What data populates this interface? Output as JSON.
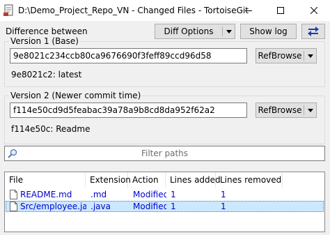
{
  "window": {
    "title": "D:\\Demo_Project_Repo_VN - Changed Files - TortoiseGit",
    "minimize_icon": "minimize-icon",
    "maximize_icon": "maximize-icon",
    "close_icon": "close-icon"
  },
  "header": {
    "difference_label": "Difference between",
    "diff_options_label": "Diff Options",
    "show_log_label": "Show log",
    "swap_icon": "swap-arrows-icon"
  },
  "version1": {
    "legend": "Version 1 (Base)",
    "hash": "9e8021c234ccb80ca9676690f3feff89ccd96d58",
    "refbrowse_label": "RefBrowse",
    "description": "9e8021c2: latest"
  },
  "version2": {
    "legend": "Version 2 (Newer commit time)",
    "hash": "f114e50cd9d5feabac39a78a9b8cd8da952f62a2",
    "refbrowse_label": "RefBrowse",
    "description": "f114e50c: Readme"
  },
  "filter": {
    "placeholder": "Filter paths",
    "icon": "search-icon"
  },
  "files": {
    "columns": [
      "File",
      "Extension",
      "Action",
      "Lines added",
      "Lines removed"
    ],
    "rows": [
      {
        "file": "README.md",
        "extension": ".md",
        "action": "Modified",
        "added": "1",
        "removed": "1",
        "selected": false
      },
      {
        "file": "Src/employee.java",
        "extension": ".java",
        "action": "Modified",
        "added": "1",
        "removed": "1",
        "selected": true
      }
    ]
  },
  "colors": {
    "accent_blue": "#0000cc",
    "selection": "#cce8ff",
    "swap_icon_blue": "#1e3ea8"
  }
}
